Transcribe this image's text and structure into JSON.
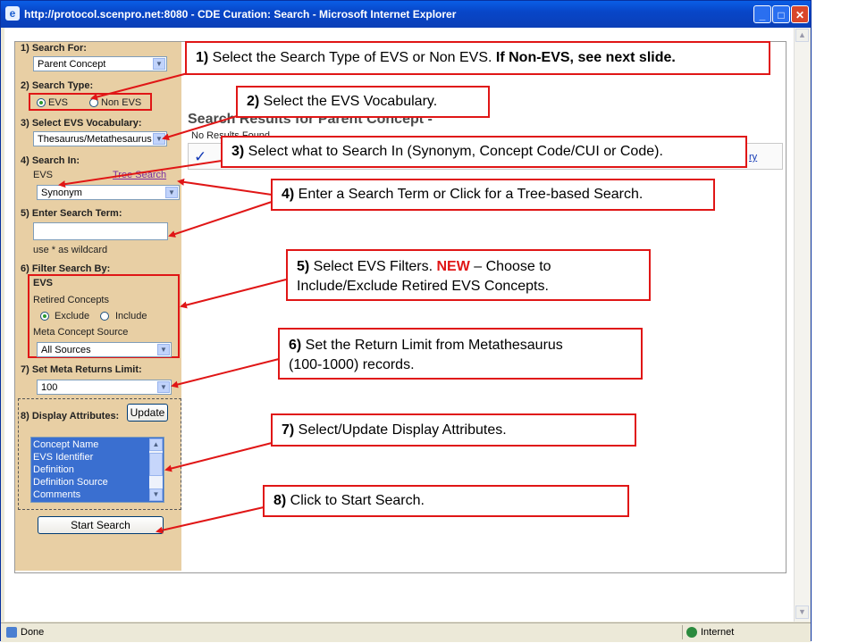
{
  "window": {
    "title": "http://protocol.scenpro.net:8080 - CDE Curation: Search - Microsoft Internet Explorer",
    "minimize": "_",
    "maximize": "□",
    "close": "✕"
  },
  "statusbar": {
    "text": "Done",
    "zone": "Internet"
  },
  "panel": {
    "search_for_label": "1) Search For:",
    "search_for_value": "Parent Concept",
    "search_type_label": "2) Search Type:",
    "search_type_options": [
      "EVS",
      "Non EVS"
    ],
    "search_type_selected": "EVS",
    "vocab_label": "3) Select EVS Vocabulary:",
    "vocab_value": "Thesaurus/Metathesaurus",
    "search_in_label": "4) Search In:",
    "search_in_sub": "EVS",
    "tree_search_link": "Tree Search",
    "search_in_value": "Synonym",
    "term_label": "5) Enter Search Term:",
    "term_value": "",
    "wildcard_hint": "use * as wildcard",
    "filter_label": "6) Filter Search By:",
    "filter_evs": "EVS",
    "retired_label": "Retired Concepts",
    "retired_options": [
      "Exclude",
      "Include"
    ],
    "retired_selected": "Exclude",
    "meta_source_label": "Meta Concept Source",
    "meta_source_value": "All Sources",
    "limit_label": "7) Set Meta Returns Limit:",
    "limit_value": "100",
    "display_label": "8) Display Attributes:",
    "update_button": "Update",
    "attributes": [
      "Concept Name",
      "EVS Identifier",
      "Definition",
      "Definition Source",
      "Comments"
    ],
    "start_button": "Start Search"
  },
  "results": {
    "title": "Search Results for Parent Concept -",
    "no_results": "No Results Found",
    "link_fragment": "ry"
  },
  "callouts": {
    "c1_num": "1)",
    "c1_text": " Select the Search Type of EVS or Non EVS. ",
    "c1_bold": "If Non-EVS, see next slide.",
    "c2_num": "2)",
    "c2_text": " Select the EVS Vocabulary.",
    "c3_num": "3)",
    "c3_text": " Select what to Search In (Synonym, Concept Code/CUI or Code).",
    "c4_num": "4)",
    "c4_text": " Enter a Search Term or Click for a Tree-based Search.",
    "c5_num": "5)",
    "c5_text": " Select EVS Filters. ",
    "c5_new": "NEW",
    "c5_rest": " – Choose to",
    "c5_line2": "Include/Exclude Retired EVS Concepts.",
    "c6_num": "6)",
    "c6_text": " Set the Return Limit from Metathesaurus",
    "c6_line2": "(100-1000) records.",
    "c7_num": "7)",
    "c7_text": " Select/Update Display Attributes.",
    "c8_num": "8)",
    "c8_text": " Click to Start Search."
  }
}
